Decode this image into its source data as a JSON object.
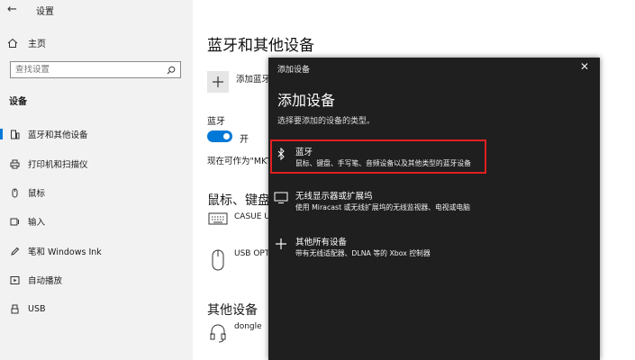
{
  "window": {
    "back": "←",
    "title": "设置"
  },
  "sidebar": {
    "home": "主页",
    "search_placeholder": "查找设置",
    "section": "设备",
    "items": [
      {
        "label": "蓝牙和其他设备",
        "icon": "bluetooth-device-icon",
        "active": true
      },
      {
        "label": "打印机和扫描仪",
        "icon": "printer-icon"
      },
      {
        "label": "鼠标",
        "icon": "mouse-icon"
      },
      {
        "label": "输入",
        "icon": "keyboard-icon"
      },
      {
        "label": "笔和 Windows Ink",
        "icon": "pen-icon"
      },
      {
        "label": "自动播放",
        "icon": "autoplay-icon"
      },
      {
        "label": "USB",
        "icon": "usb-icon"
      }
    ]
  },
  "main": {
    "title": "蓝牙和其他设备",
    "add_label": "添加蓝牙",
    "bluetooth_label": "蓝牙",
    "toggle_label": "开",
    "discover_text": "现在可作为\"MKT",
    "section_mouse": "鼠标、键盘和",
    "device1": "CASUE U",
    "device2": "USB OPT",
    "section_other": "其他设备",
    "device3": "dongle"
  },
  "dialog": {
    "header": "添加设备",
    "close": "✕",
    "title": "添加设备",
    "subtitle": "选择要添加的设备的类型。",
    "options": [
      {
        "title": "蓝牙",
        "desc": "鼠标、键盘、手写笔、音频设备以及其他类型的蓝牙设备"
      },
      {
        "title": "无线显示器或扩展坞",
        "desc": "使用 Miracast 或无线扩展坞的无线监视器、电视或电脑"
      },
      {
        "title": "其他所有设备",
        "desc": "带有无线适配器、DLNA 等的 Xbox 控制器"
      }
    ]
  },
  "colors": {
    "accent": "#0078d7",
    "highlight": "#e02020",
    "dialog_bg": "#1f1f1f"
  }
}
